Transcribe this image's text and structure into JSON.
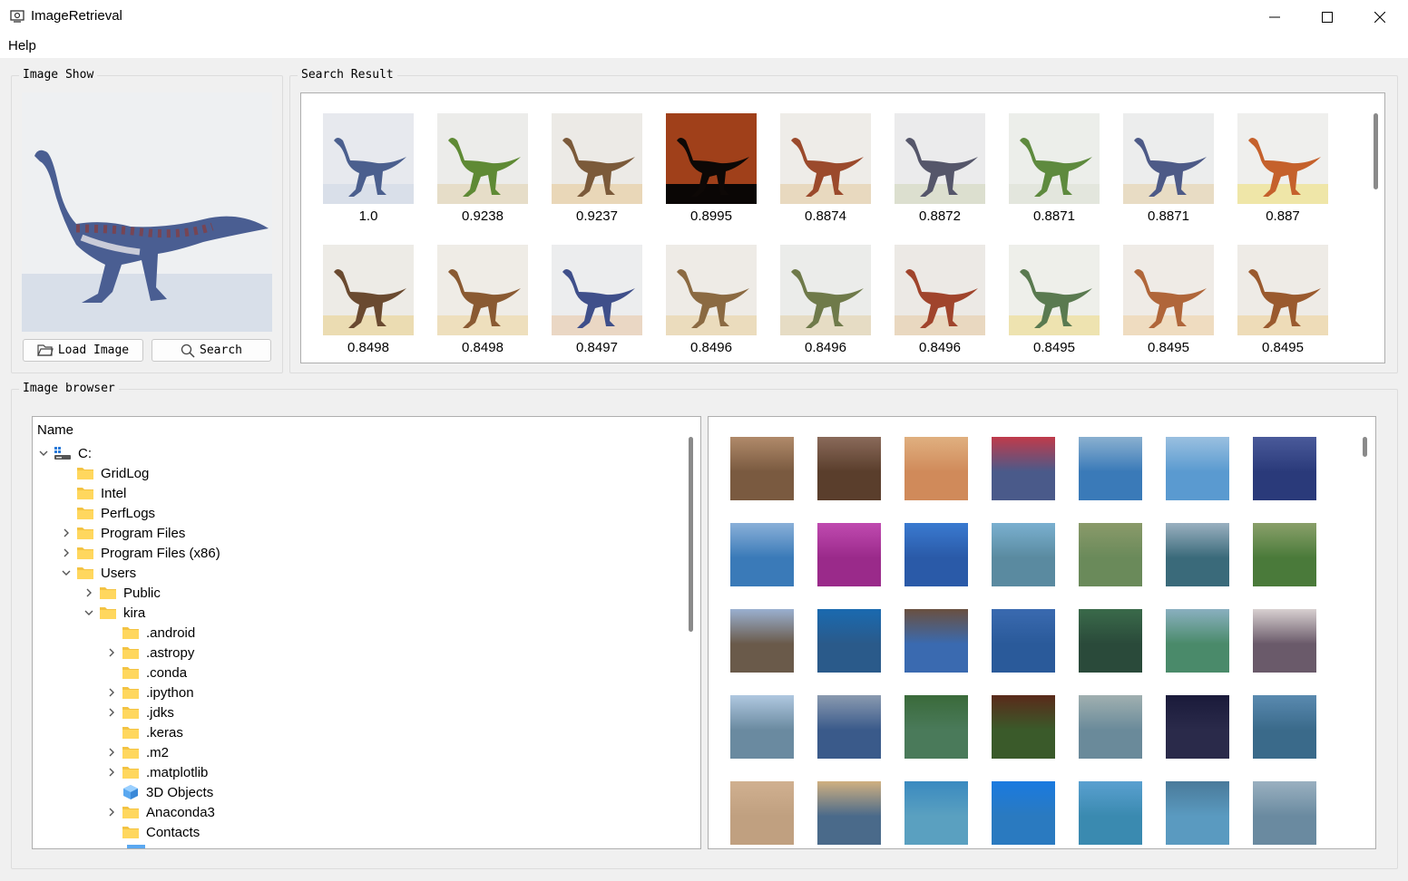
{
  "window": {
    "title": "ImageRetrieval",
    "icon": "image-app-icon"
  },
  "menu": {
    "help": "Help"
  },
  "image_show": {
    "title": "Image Show",
    "query_image": "dinosaur-query-image",
    "load_button": {
      "label": "Load Image",
      "icon": "folder-open-icon"
    },
    "search_button": {
      "label": "Search",
      "icon": "search-icon"
    }
  },
  "search_result": {
    "title": "Search Result",
    "results": [
      {
        "score": "1.0",
        "bg": "#dfe3ea",
        "body": "#4b5f8e",
        "sky": "#e7e9ee",
        "ground": "#d9dfe9"
      },
      {
        "score": "0.9238",
        "bg": "#e8e8e0",
        "body": "#5f8a35",
        "sky": "#ececea",
        "ground": "#e6ddc8"
      },
      {
        "score": "0.9237",
        "bg": "#e6e3dc",
        "body": "#7b5a3a",
        "sky": "#eceae6",
        "ground": "#e9d7b8"
      },
      {
        "score": "0.8995",
        "bg": "#6a2a12",
        "body": "#0d0806",
        "sky": "#a0401a",
        "ground": "#0a0605"
      },
      {
        "score": "0.8874",
        "bg": "#e9e6e0",
        "body": "#9b4a2c",
        "sky": "#eeece8",
        "ground": "#e8d9bf"
      },
      {
        "score": "0.8872",
        "bg": "#e4e5e6",
        "body": "#55566a",
        "sky": "#ebebec",
        "ground": "#dcdfcf"
      },
      {
        "score": "0.8871",
        "bg": "#e6e8e4",
        "body": "#5e8a3e",
        "sky": "#eceeea",
        "ground": "#e3e6dd"
      },
      {
        "score": "0.8871",
        "bg": "#e5e6e8",
        "body": "#4d5a87",
        "sky": "#eceded",
        "ground": "#e8dcc4"
      },
      {
        "score": "0.887",
        "bg": "#ececea",
        "body": "#c5612c",
        "sky": "#efefed",
        "ground": "#efe6a8"
      },
      {
        "score": "0.8498",
        "bg": "#e8e6e0",
        "body": "#6a4a30",
        "sky": "#edebe6",
        "ground": "#ebdcb2"
      },
      {
        "score": "0.8498",
        "bg": "#ebe8e0",
        "body": "#8a5a32",
        "sky": "#efece6",
        "ground": "#eedfbd"
      },
      {
        "score": "0.8497",
        "bg": "#e6e7e9",
        "body": "#3f4f8a",
        "sky": "#ecedee",
        "ground": "#ead7c4"
      },
      {
        "score": "0.8496",
        "bg": "#e9e6e0",
        "body": "#8b6a42",
        "sky": "#eeebe6",
        "ground": "#ebdcbd"
      },
      {
        "score": "0.8496",
        "bg": "#e5e6e2",
        "body": "#6f7a4a",
        "sky": "#ebecea",
        "ground": "#e6dcc4"
      },
      {
        "score": "0.8496",
        "bg": "#e8e4df",
        "body": "#a0442c",
        "sky": "#ece9e5",
        "ground": "#e9d8c0"
      },
      {
        "score": "0.8495",
        "bg": "#e9eae4",
        "body": "#5a7a50",
        "sky": "#eeefea",
        "ground": "#eee3b0"
      },
      {
        "score": "0.8495",
        "bg": "#ebe6e0",
        "body": "#b0663a",
        "sky": "#efebe6",
        "ground": "#efdcc0"
      },
      {
        "score": "0.8495",
        "bg": "#ebe7e1",
        "body": "#9a5a2e",
        "sky": "#eeebe6",
        "ground": "#eedcb8"
      }
    ]
  },
  "image_browser": {
    "title": "Image browser",
    "tree": {
      "header": "Name",
      "items": [
        {
          "label": "C:",
          "depth": 0,
          "arrow": "down",
          "icon": "drive"
        },
        {
          "label": "GridLog",
          "depth": 1,
          "arrow": "none",
          "icon": "folder"
        },
        {
          "label": "Intel",
          "depth": 1,
          "arrow": "none",
          "icon": "folder"
        },
        {
          "label": "PerfLogs",
          "depth": 1,
          "arrow": "none",
          "icon": "folder"
        },
        {
          "label": "Program Files",
          "depth": 1,
          "arrow": "right",
          "icon": "folder"
        },
        {
          "label": "Program Files (x86)",
          "depth": 1,
          "arrow": "right",
          "icon": "folder"
        },
        {
          "label": "Users",
          "depth": 1,
          "arrow": "down",
          "icon": "folder"
        },
        {
          "label": "Public",
          "depth": 2,
          "arrow": "right",
          "icon": "folder"
        },
        {
          "label": "kira",
          "depth": 2,
          "arrow": "down",
          "icon": "folder"
        },
        {
          "label": ".android",
          "depth": 3,
          "arrow": "none",
          "icon": "folder"
        },
        {
          "label": ".astropy",
          "depth": 3,
          "arrow": "right",
          "icon": "folder"
        },
        {
          "label": ".conda",
          "depth": 3,
          "arrow": "none",
          "icon": "folder"
        },
        {
          "label": ".ipython",
          "depth": 3,
          "arrow": "right",
          "icon": "folder"
        },
        {
          "label": ".jdks",
          "depth": 3,
          "arrow": "right",
          "icon": "folder"
        },
        {
          "label": ".keras",
          "depth": 3,
          "arrow": "none",
          "icon": "folder"
        },
        {
          "label": ".m2",
          "depth": 3,
          "arrow": "right",
          "icon": "folder"
        },
        {
          "label": ".matplotlib",
          "depth": 3,
          "arrow": "right",
          "icon": "folder"
        },
        {
          "label": "3D Objects",
          "depth": 3,
          "arrow": "none",
          "icon": "cube"
        },
        {
          "label": "Anaconda3",
          "depth": 3,
          "arrow": "right",
          "icon": "folder"
        },
        {
          "label": "Contacts",
          "depth": 3,
          "arrow": "none",
          "icon": "folder"
        }
      ]
    },
    "thumbnails": [
      [
        "#7a5a40",
        "#5a3e2c",
        "#d08a5a",
        "#4a5a8a",
        "#3a7ab8",
        "#5a9ad0",
        "#2a3a7a"
      ],
      [
        "#3a7ab8",
        "#9a2a8a",
        "#2a5aa8",
        "#5a8aa0",
        "#6a8a5a",
        "#3a6a7a",
        "#4a7a3a"
      ],
      [
        "#6a5a4a",
        "#2a5a8a",
        "#3a6ab0",
        "#2a5a9a",
        "#2a4a3a",
        "#4a8a6a",
        "#6a5a6a"
      ],
      [
        "#6a8aa0",
        "#3a5a8a",
        "#4a7a5a",
        "#3a5a2a",
        "#6a8a9a",
        "#2a2a4a",
        "#3a6a8a"
      ],
      [
        "#c0a080",
        "#4a6a8a",
        "#5aa0c0",
        "#2a7ac0",
        "#3a8ab0",
        "#5a9ac0",
        "#6a8aa0"
      ]
    ],
    "grid_top_colors": [
      [
        "#b08a6a",
        "#8a6a5a",
        "#e0b080",
        "#c03a4a",
        "#8ab0d0",
        "#9ac0e0",
        "#4a5a9a"
      ],
      [
        "#8ab0d8",
        "#c04ab0",
        "#3a7ad0",
        "#7ab0d0",
        "#8a9a6a",
        "#9ab0c0",
        "#8aa06a"
      ],
      [
        "#9ab0d0",
        "#1a6ab0",
        "#6a5040",
        "#3a6ab0",
        "#3a6a4a",
        "#8ab0c0",
        "#d8d0d0"
      ],
      [
        "#b0c8e0",
        "#8a9ab0",
        "#3a6a3a",
        "#5a2a1a",
        "#a0b0b0",
        "#1a1a3a",
        "#5a8ab0"
      ],
      [
        "#d0b090",
        "#d0b080",
        "#3a8ac0",
        "#1a7ae0",
        "#5aa0d0",
        "#4a7a9a",
        "#9ab0c0"
      ]
    ]
  }
}
